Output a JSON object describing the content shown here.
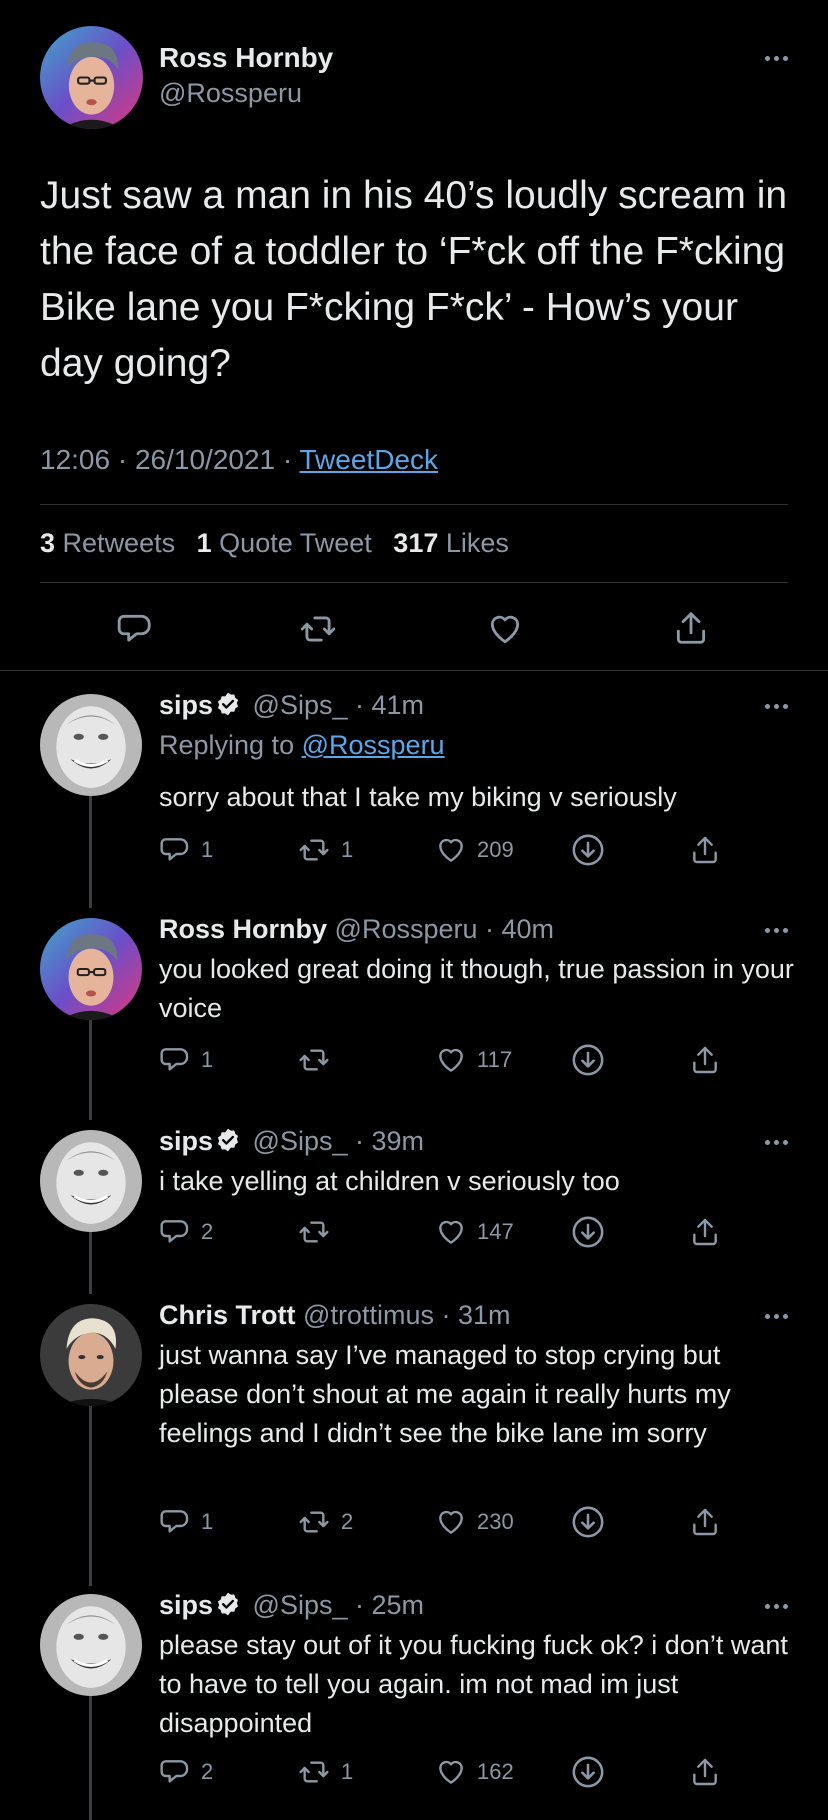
{
  "main_tweet": {
    "author_name": "Ross Hornby",
    "author_handle": "@Rossperu",
    "text": "Just saw a man in his 40’s loudly scream in the face of a toddler to ‘F*ck off the F*cking Bike lane you F*cking F*ck’ - How’s your day going?",
    "time": "12:06",
    "date": "26/10/2021",
    "source": "TweetDeck",
    "stats": {
      "retweets_count": "3",
      "retweets_label": "Retweets",
      "quotes_count": "1",
      "quotes_label": "Quote Tweet",
      "likes_count": "317",
      "likes_label": "Likes"
    },
    "actions": [
      "reply-icon",
      "retweet-icon",
      "like-icon",
      "share-icon"
    ]
  },
  "replies": [
    {
      "name": "sips",
      "verified": true,
      "handle": "@Sips_",
      "age": "41m",
      "replying_label": "Replying to",
      "replying_handle": "@Rossperu",
      "text": "sorry about that I take my biking v seriously",
      "replies": "1",
      "retweets": "1",
      "likes": "209"
    },
    {
      "name": "Ross Hornby",
      "verified": false,
      "handle": "@Rossperu",
      "age": "40m",
      "text": "you looked great doing it though, true passion in your voice",
      "replies": "1",
      "retweets": "",
      "likes": "117"
    },
    {
      "name": "sips",
      "verified": true,
      "handle": "@Sips_",
      "age": "39m",
      "text": "i take yelling at children v seriously too",
      "replies": "2",
      "retweets": "",
      "likes": "147"
    },
    {
      "name": "Chris Trott",
      "verified": false,
      "handle": "@trottimus",
      "age": "31m",
      "text": "just wanna say I’ve managed to stop crying but please don’t shout at me again it really hurts my feelings and I didn’t see the bike lane im sorry",
      "replies": "1",
      "retweets": "2",
      "likes": "230"
    },
    {
      "name": "sips",
      "verified": true,
      "handle": "@Sips_",
      "age": "25m",
      "text": "please stay out of it you fucking fuck ok? i don’t want to have to tell you again. im not mad im just disappointed",
      "replies": "2",
      "retweets": "1",
      "likes": "162"
    }
  ],
  "colors": {
    "background": "#000000",
    "text": "#e7e9ea",
    "muted": "#8b98a5",
    "link": "#5aa7e8",
    "divider": "#2f3336"
  }
}
